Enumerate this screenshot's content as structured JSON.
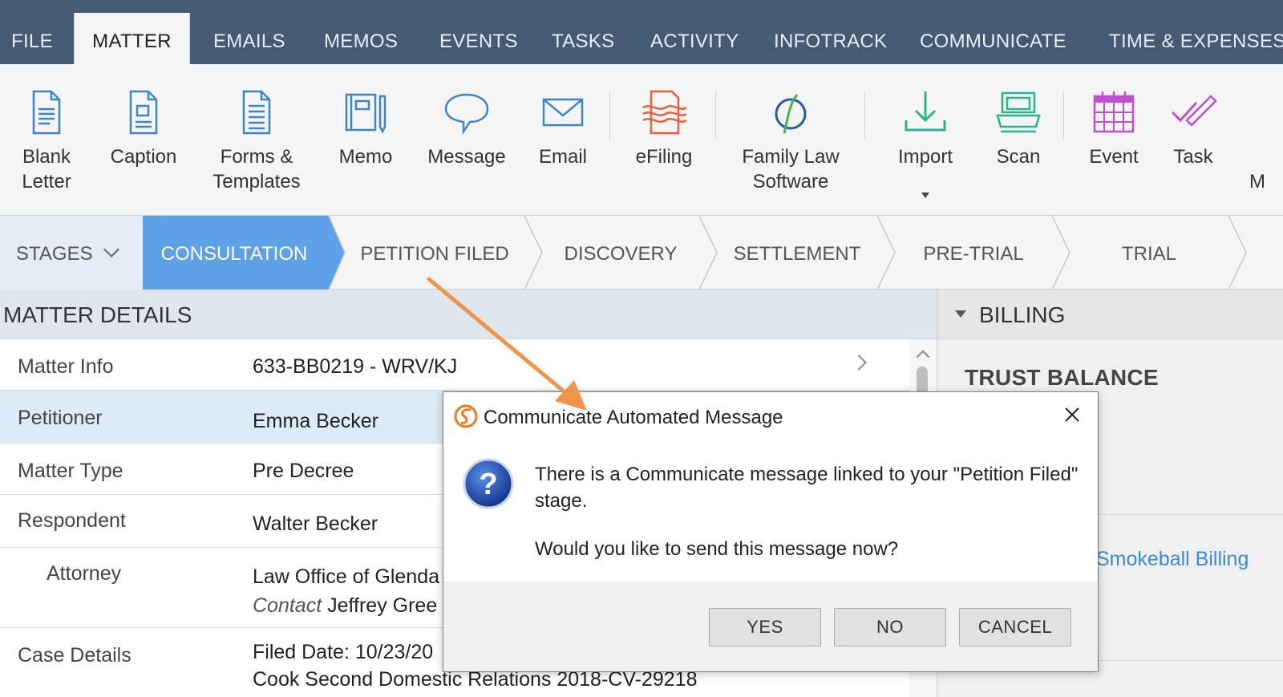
{
  "menubar": {
    "tabs": [
      "FILE",
      "MATTER",
      "EMAILS",
      "MEMOS",
      "EVENTS",
      "TASKS",
      "ACTIVITY",
      "INFOTRACK",
      "COMMUNICATE",
      "TIME & EXPENSES"
    ],
    "active": "MATTER"
  },
  "ribbon": {
    "buttons": [
      {
        "line1": "Blank",
        "line2": "Letter",
        "icon": "blank-letter-icon"
      },
      {
        "line1": "Caption",
        "line2": "",
        "icon": "caption-icon"
      },
      {
        "line1": "Forms &",
        "line2": "Templates",
        "icon": "forms-templates-icon"
      },
      {
        "line1": "Memo",
        "line2": "",
        "icon": "memo-icon"
      },
      {
        "line1": "Message",
        "line2": "",
        "icon": "message-icon"
      },
      {
        "line1": "Email",
        "line2": "",
        "icon": "email-icon"
      },
      {
        "line1": "eFiling",
        "line2": "",
        "icon": "efiling-icon"
      },
      {
        "line1": "Family Law",
        "line2": "Software",
        "icon": "family-law-software-icon"
      },
      {
        "line1": "Import",
        "line2": "",
        "icon": "import-icon"
      },
      {
        "line1": "Scan",
        "line2": "",
        "icon": "scan-icon"
      },
      {
        "line1": "Event",
        "line2": "",
        "icon": "event-icon"
      },
      {
        "line1": "Task",
        "line2": "",
        "icon": "task-icon"
      },
      {
        "line1": "",
        "line2": "M",
        "icon": ""
      }
    ],
    "colors": {
      "blue": "#3d86c6",
      "orange": "#e8613c",
      "teal": "#2bb38e",
      "purple": "#c04fd0"
    }
  },
  "stages": {
    "dropdown_label": "STAGES",
    "items": [
      "CONSULTATION",
      "PETITION FILED",
      "DISCOVERY",
      "SETTLEMENT",
      "PRE-TRIAL",
      "TRIAL"
    ],
    "active": "CONSULTATION",
    "active_color": "#5ea1e6"
  },
  "matter_details": {
    "header": "MATTER DETAILS",
    "rows": [
      {
        "key": "Matter Info",
        "value": "633-BB0219 - WRV/KJ"
      },
      {
        "key": "Petitioner",
        "value": "Emma Becker"
      },
      {
        "key": "Matter Type",
        "value": "Pre Decree"
      },
      {
        "key": "Respondent",
        "value": "Walter Becker"
      },
      {
        "key": "Attorney",
        "value": "Law Office of Glenda",
        "contact_label": "Contact",
        "contact_value": "Jeffrey Gree"
      },
      {
        "key": "Case Details",
        "value": "Filed Date: 10/23/20",
        "value2": "Cook Second Domestic Relations 2018-CV-29218"
      }
    ]
  },
  "billing": {
    "header": "BILLING",
    "trust_balance": "TRUST BALANCE",
    "link": "Smokeball Billing"
  },
  "dialog": {
    "title": "Communicate Automated Message",
    "message": "There is a Communicate message linked to your \"Petition Filed\" stage.",
    "question": "Would you like to send this message now?",
    "buttons": {
      "yes": "YES",
      "no": "NO",
      "cancel": "CANCEL"
    }
  }
}
